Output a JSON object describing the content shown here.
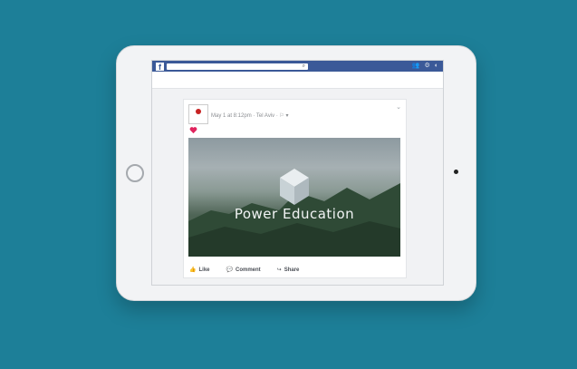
{
  "post": {
    "meta_text": "May 1 at 8:12pm · Tel Aviv ·",
    "brand_text": "Power Education"
  },
  "actions": {
    "like": "Like",
    "comment": "Comment",
    "share": "Share"
  },
  "colors": {
    "background": "#1d7f98",
    "facebook_blue": "#3b5998",
    "heart": "#e0245e"
  },
  "icons": {
    "facebook_logo": "facebook-logo-icon",
    "search": "search-icon",
    "friends": "friends-icon",
    "settings": "gear-icon",
    "profile": "profile-icon"
  }
}
